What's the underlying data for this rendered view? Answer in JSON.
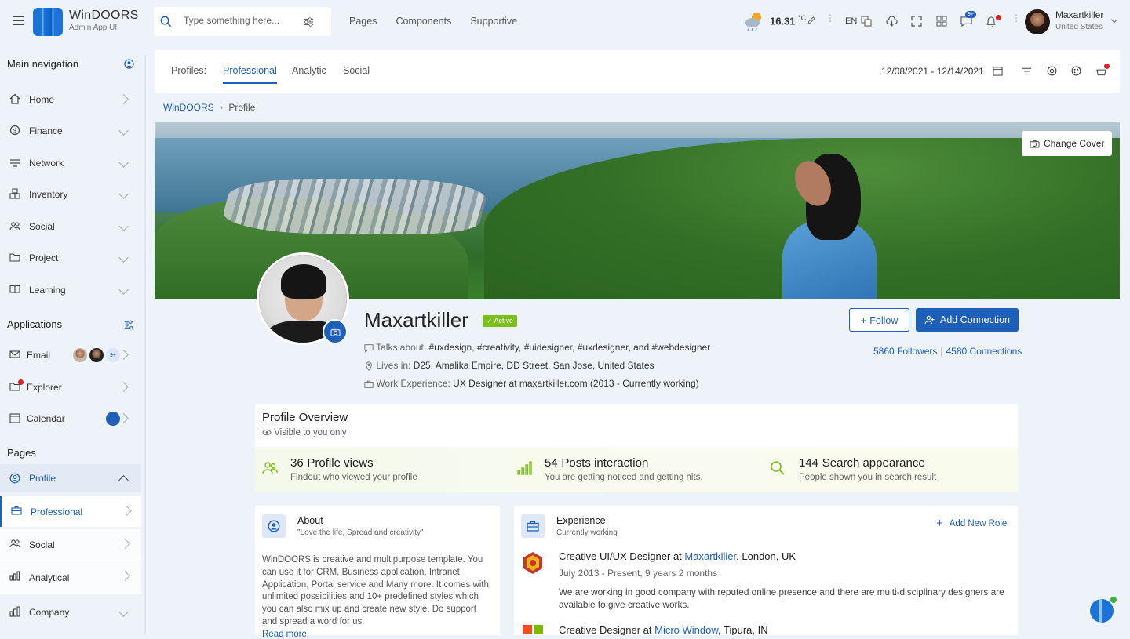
{
  "app": {
    "name": "WinDOORS",
    "subtitle": "Admin App UI"
  },
  "search": {
    "placeholder": "Type something here..."
  },
  "topnav": [
    "Pages",
    "Components",
    "Supportive"
  ],
  "weather": {
    "temp": "16.31",
    "unit": "°C"
  },
  "lang": "EN",
  "notifications": {
    "messages_badge": "9+"
  },
  "user": {
    "name": "Maxartkiller",
    "location": "United States"
  },
  "sidebar": {
    "main_heading": "Main navigation",
    "main_items": [
      "Home",
      "Finance",
      "Network",
      "Inventory",
      "Social",
      "Project",
      "Learning"
    ],
    "apps_heading": "Applications",
    "app_items": [
      "Email",
      "Explorer",
      "Calendar"
    ],
    "email_badge": "9+",
    "pages_heading": "Pages",
    "page_items": [
      "Profile",
      "Professional",
      "Social",
      "Analytical",
      "Company"
    ]
  },
  "tabs": {
    "label": "Profiles:",
    "items": [
      "Professional",
      "Analytic",
      "Social"
    ],
    "active": "Professional"
  },
  "daterange": "12/08/2021 - 12/14/2021",
  "breadcrumb": {
    "root": "WinDOORS",
    "sep": "›",
    "current": "Profile"
  },
  "cover": {
    "change_label": "Change Cover"
  },
  "profile": {
    "name": "Maxartkiller",
    "status": "Active",
    "talks_label": "Talks about:",
    "talks": "#uxdesign, #creativity, #uidesigner, #uxdesigner, and #webdesigner",
    "lives_label": "Lives in:",
    "lives": "D25, Amalika Empire, DD Street, San Jose, United States",
    "work_label": "Work Experience:",
    "work": "UX Designer at maxartkiller.com (2013 - Currently working)",
    "follow_label": "Follow",
    "add_connection_label": "Add Connection",
    "followers": "5860 Followers",
    "connections_sep": "|",
    "connections": "4580 Connections"
  },
  "overview": {
    "title": "Profile Overview",
    "visibility": "Visible to you only",
    "stats": [
      {
        "num": "36",
        "label": "Profile views",
        "desc": "Findout who viewed your profile"
      },
      {
        "num": "54",
        "label": "Posts interaction",
        "desc": "You are getting noticed and getting hits."
      },
      {
        "num": "144",
        "label": "Search appearance",
        "desc": "People shown you in search result"
      }
    ]
  },
  "about": {
    "title": "About",
    "quote": "\"Love the life, Spread and creativity\"",
    "text": "WinDOORS is creative and multipurpose template. You can use it for CRM, Business application, Intranet Application, Portal service and Many more. It comes with unlimited possibilities and 10+ predefined styles which you can also mix up and create new style. Do support and spread a word for us.",
    "readmore": "Read more"
  },
  "experience": {
    "title": "Experience",
    "subtitle": "Currently working",
    "add_label": "Add New Role",
    "jobs": [
      {
        "role": "Creative UI/UX Designer at ",
        "company": "Maxartkiller",
        "location": ", London, UK",
        "date": "July 2013 - Present, 9 years 2 months",
        "desc": "We are working in good company with reputed online presence and there are multi-disciplinary designers are available to give creative works."
      },
      {
        "role": "Creative Designer at ",
        "company": "Micro Window",
        "location": ", Tipura, IN"
      }
    ]
  },
  "colors": {
    "accent": "#1e5fb8",
    "active": "#7bbf1a",
    "alert": "#e02020"
  }
}
